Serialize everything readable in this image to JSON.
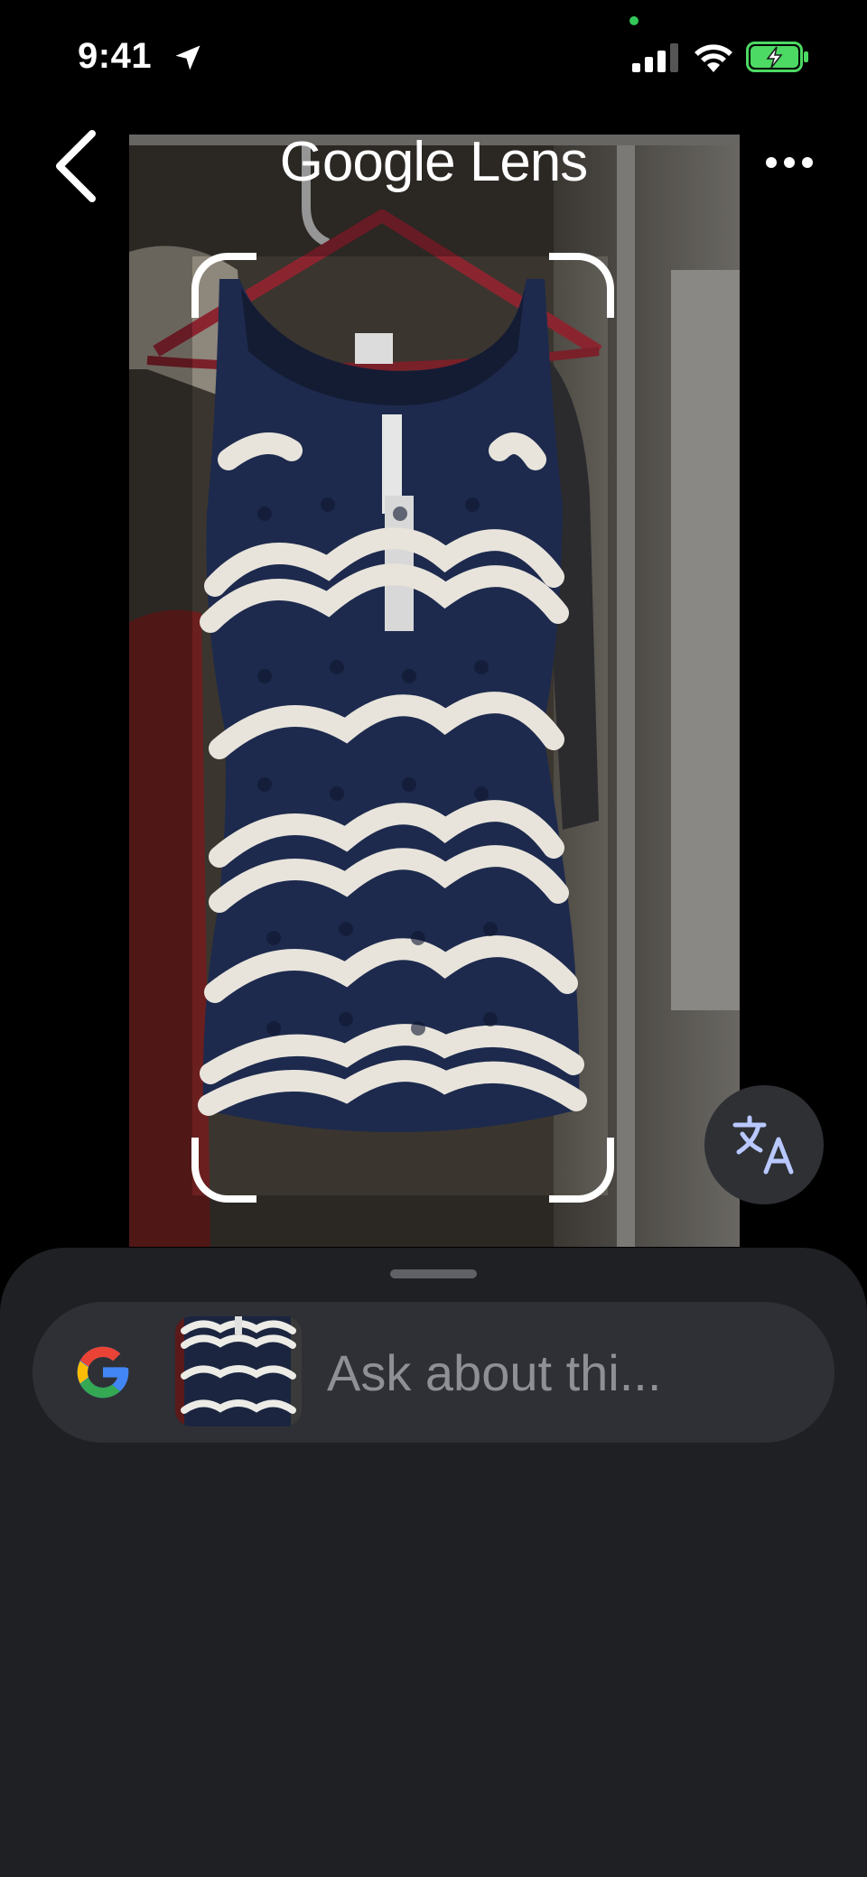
{
  "status_bar": {
    "time": "9:41",
    "icons": [
      "location-arrow-icon",
      "signal-icon",
      "wifi-icon",
      "battery-charging-icon"
    ],
    "battery_color": "#4cd964"
  },
  "header": {
    "title": "Google Lens",
    "back_icon": "chevron-left-icon",
    "more_icon": "more-horizontal-icon"
  },
  "viewer": {
    "subject": "crochet dress on hanger",
    "accent_colors": {
      "dress": "#1d2a4d",
      "stripes": "#e8e4dc",
      "hanger": "#8a2530"
    },
    "translate_icon": "translate-icon"
  },
  "search": {
    "logo": "google-g-icon",
    "placeholder": "Ask about thi...",
    "value": ""
  },
  "colors": {
    "sheet_bg": "#1f2024",
    "search_bg": "#2e3035",
    "placeholder": "#8e9095"
  }
}
